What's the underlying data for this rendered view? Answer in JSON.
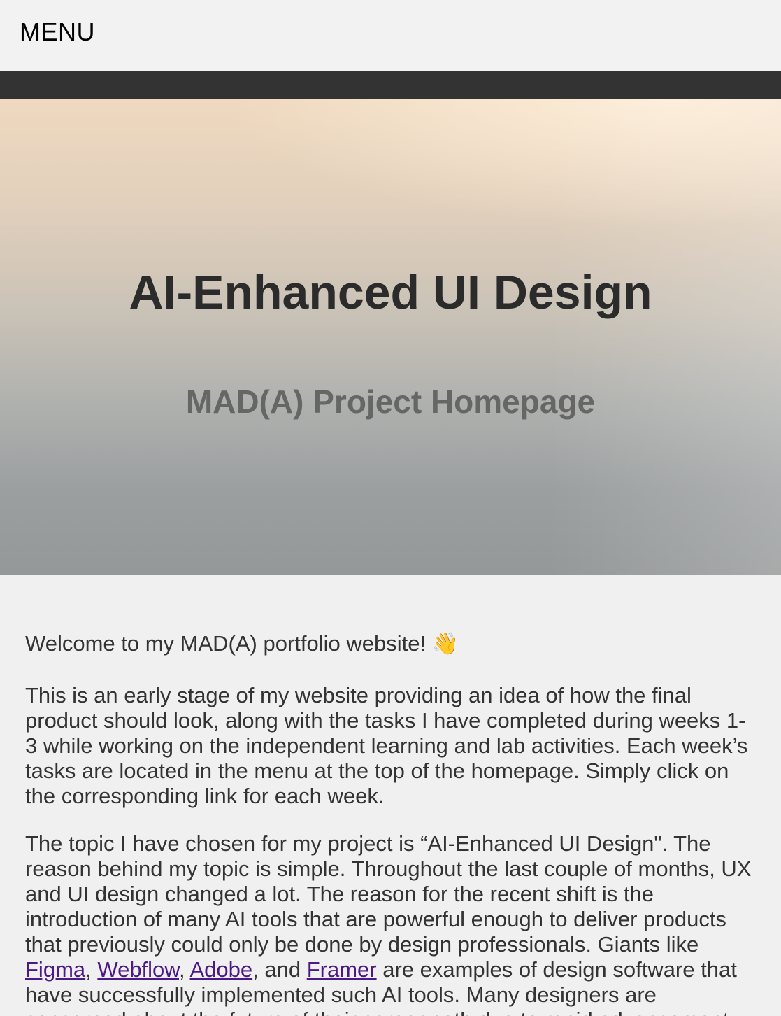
{
  "header": {
    "menu_label": "MENU"
  },
  "hero": {
    "title": "AI-Enhanced UI Design",
    "subtitle": "MAD(A) Project Homepage"
  },
  "content": {
    "welcome": "Welcome to my MAD(A) portfolio website!",
    "welcome_emoji": "👋",
    "paragraph1": "This is an early stage of my website providing an idea of how the final product should look, along with the tasks I have completed during weeks 1-3 while working on the independent learning and lab activities. Each week’s tasks are located in the menu at the top of the homepage. Simply click on the corresponding link for each week.",
    "paragraph2_intro": "The topic I have chosen for my project is “AI-Enhanced UI Design\". The reason behind my topic is simple. Throughout the last couple of months, UX and UI design changed a lot. The reason for the recent shift is the introduction of many AI tools that are powerful enough to deliver products that previously could only be done by design professionals. Giants like ",
    "links": {
      "figma": "Figma",
      "webflow": "Webflow",
      "adobe": "Adobe",
      "framer": "Framer"
    },
    "sep_comma": ", ",
    "sep_and": ", and ",
    "paragraph2_rest": " are examples of design software that have successfully implemented such AI tools. Many designers are concerned about the future of their career path due to rapid advancement"
  },
  "colors": {
    "background": "#f0f0f0",
    "dark_bar": "#333333",
    "link": "#4b1a86",
    "title": "#2b2b2b",
    "subtitle": "#666666"
  }
}
